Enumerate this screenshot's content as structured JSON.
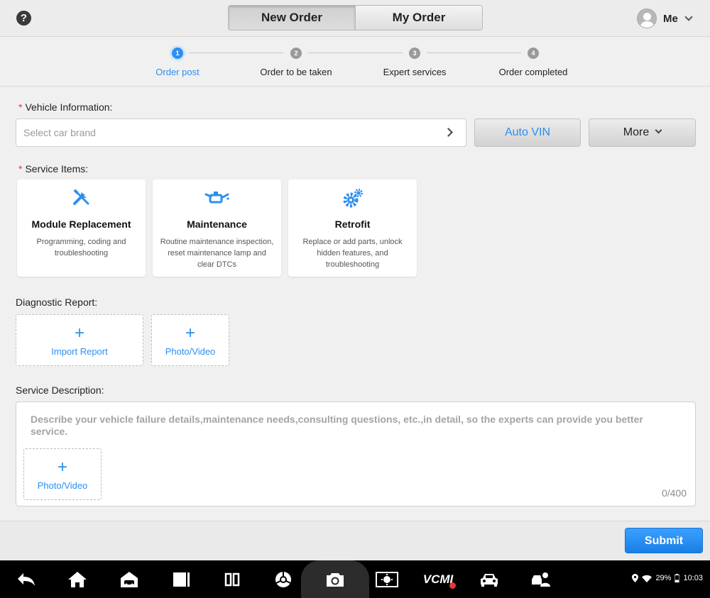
{
  "header": {
    "help_icon": "help-circle-icon",
    "tabs": [
      {
        "label": "New Order",
        "active": true
      },
      {
        "label": "My Order",
        "active": false
      }
    ],
    "user": {
      "name": "Me",
      "avatar_icon": "user-avatar-icon",
      "menu_icon": "chevron-down-icon"
    }
  },
  "stepper": {
    "steps": [
      {
        "number": "1",
        "label": "Order post",
        "active": true
      },
      {
        "number": "2",
        "label": "Order to be taken",
        "active": false
      },
      {
        "number": "3",
        "label": "Expert services",
        "active": false
      },
      {
        "number": "4",
        "label": "Order completed",
        "active": false
      }
    ]
  },
  "vehicle": {
    "required_mark": "*",
    "label": "Vehicle Information:",
    "brand_placeholder": "Select car brand",
    "auto_vin_label": "Auto VIN",
    "more_label": "More"
  },
  "service_items": {
    "required_mark": "*",
    "label": "Service Items:",
    "cards": [
      {
        "title": "Module Replacement",
        "desc": "Programming, coding and troubleshooting",
        "icon": "tools-icon"
      },
      {
        "title": "Maintenance",
        "desc": "Routine maintenance inspection, reset maintenance lamp and clear DTCs",
        "icon": "oil-can-icon"
      },
      {
        "title": "Retrofit",
        "desc": "Replace or add parts, unlock hidden features, and troubleshooting",
        "icon": "gears-icon"
      }
    ]
  },
  "diagnostic_report": {
    "label": "Diagnostic Report:",
    "import_label": "Import Report",
    "media_label": "Photo/Video",
    "plus": "+"
  },
  "service_description": {
    "label": "Service Description:",
    "placeholder": "Describe your vehicle failure details,maintenance needs,consulting questions, etc.,in detail, so the experts can provide you better service.",
    "media_label": "Photo/Video",
    "plus": "+",
    "counter": "0/400"
  },
  "footer": {
    "submit_label": "Submit"
  },
  "navbar": {
    "icons": [
      "back-icon",
      "home-icon",
      "car-home-icon",
      "recent-apps-icon",
      "split-screen-icon",
      "browser-icon",
      "camera-icon",
      "display-settings-icon",
      "vcmi-icon",
      "car-icon",
      "remote-expert-icon"
    ],
    "vcmi_text": "VCMI",
    "battery": "29%",
    "time": "10:03"
  },
  "colors": {
    "accent": "#2b8ff0",
    "required": "#e0393e",
    "submit": "#1a7fe6"
  }
}
